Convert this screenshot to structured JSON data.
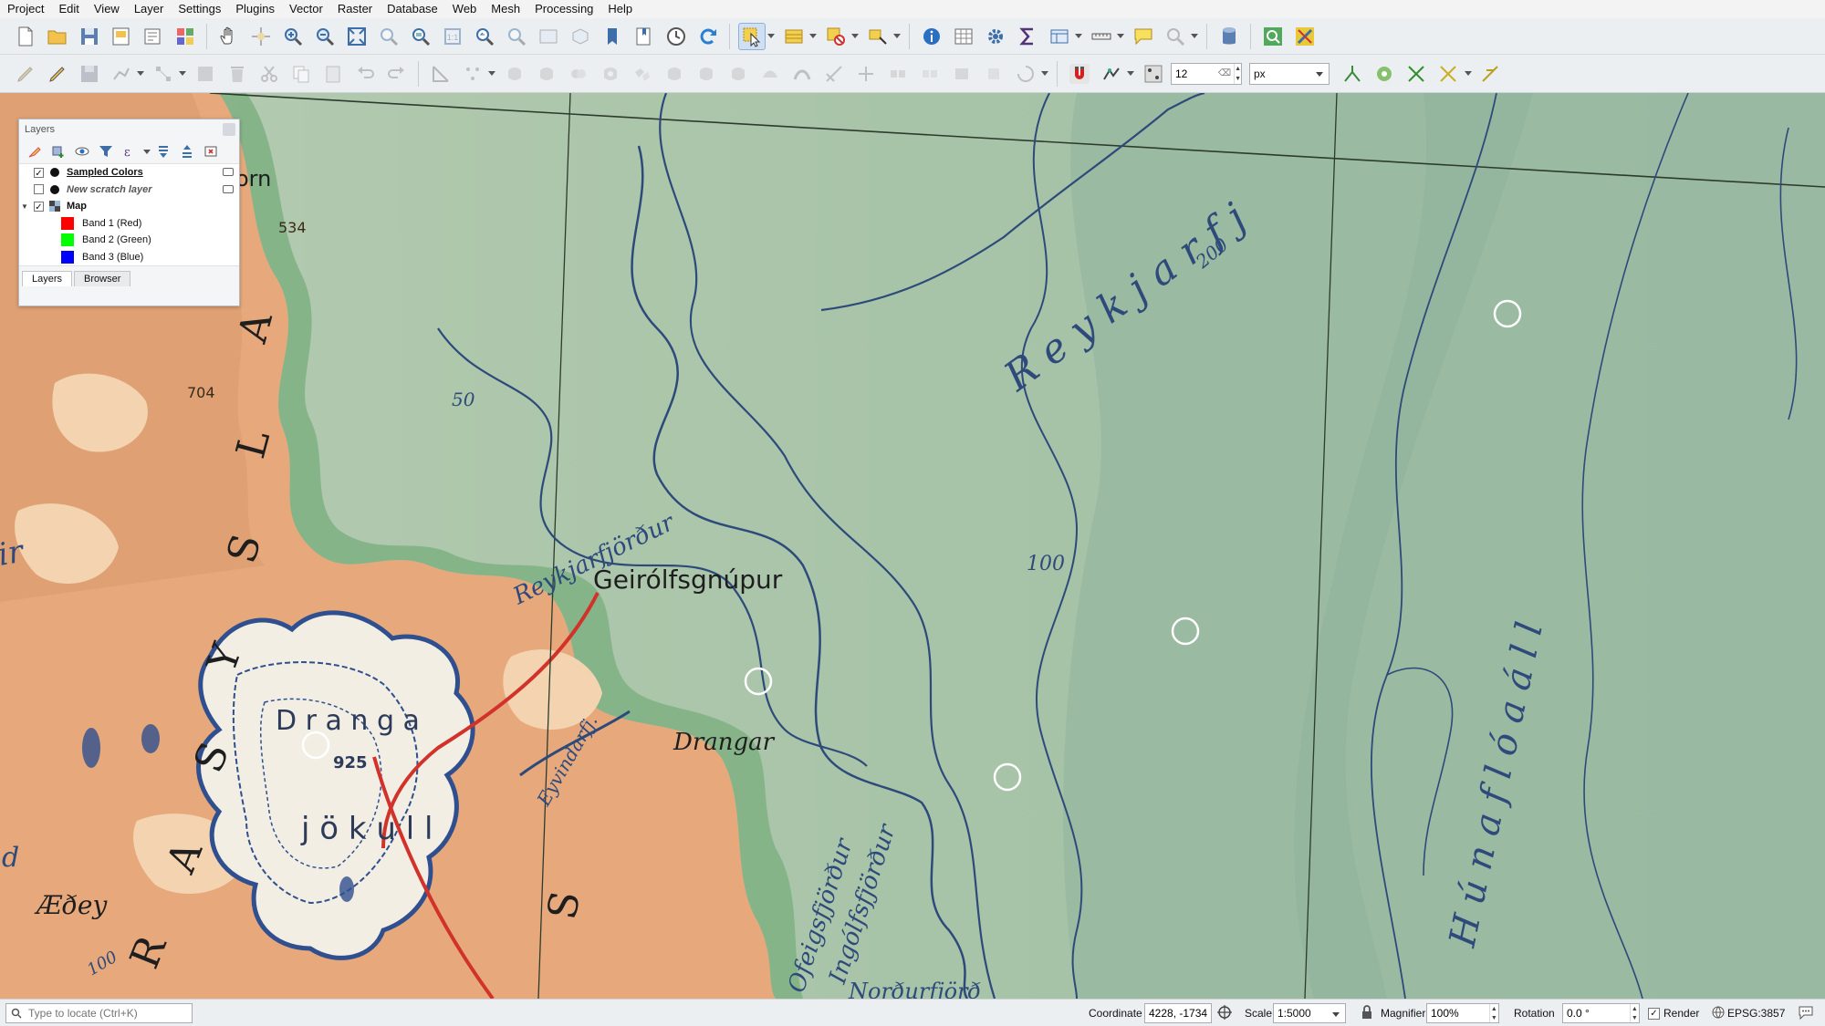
{
  "menu": [
    "Project",
    "Edit",
    "View",
    "Layer",
    "Settings",
    "Plugins",
    "Vector",
    "Raster",
    "Database",
    "Web",
    "Mesh",
    "Processing",
    "Help"
  ],
  "digitize": {
    "snap_tolerance": "12",
    "snap_unit": "px"
  },
  "layers_panel": {
    "title": "Layers",
    "layers": [
      {
        "name": "Sampled Colors",
        "checked": true
      },
      {
        "name": "New scratch layer",
        "checked": false
      },
      {
        "name": "Map",
        "checked": true
      }
    ],
    "bands": [
      {
        "name": "Band 1 (Red)",
        "color": "#ff0000"
      },
      {
        "name": "Band 2 (Green)",
        "color": "#00ff00"
      },
      {
        "name": "Band 3 (Blue)",
        "color": "#0000ff"
      }
    ],
    "tabs": [
      "Layers",
      "Browser"
    ]
  },
  "map_labels": {
    "reykjarfj": "R e y k j a r f j",
    "hunafloaall": "H ú n a f l ó a á l l",
    "geirolfsgnupur": "Geirólfsgnúpur",
    "reykjarfjordur": "Reykjarfjörður",
    "drangar": "Drangar",
    "drangajokull_top": "D r a n g a",
    "drangajokull_bot": "j ö k u l l",
    "ofeigsfjordur": "Ofeigsfjörður",
    "ingolfsfjordur": "Ingólfsfjörður",
    "eyvindarfj": "Eyvindarfj.",
    "aedey": "Æðey",
    "orn": "orn",
    "depth_50": "50",
    "depth_100": "100",
    "depth_100b": "100",
    "depth_200": "200",
    "height_534": "534",
    "height_704": "704",
    "height_925": "925",
    "strandas_1": "A",
    "strandas_2": "L",
    "strandas_3": "S",
    "strandas_4": "Y",
    "strandas_5": "S",
    "strandas_6": "A",
    "strandas_7": "R",
    "strandas_8": "S",
    "strandas_9": "ir",
    "strandas_10": "d",
    "nordurfj": "Norðurfjörð"
  },
  "status": {
    "locator_placeholder": "Type to locate (Ctrl+K)",
    "coordinate_label": "Coordinate",
    "coordinate": "4228, -1734",
    "scale_label": "Scale",
    "scale": "1:5000",
    "magnifier_label": "Magnifier",
    "magnifier": "100%",
    "rotation_label": "Rotation",
    "rotation": "0.0 °",
    "render_label": "Render",
    "crs": "EPSG:3857"
  }
}
